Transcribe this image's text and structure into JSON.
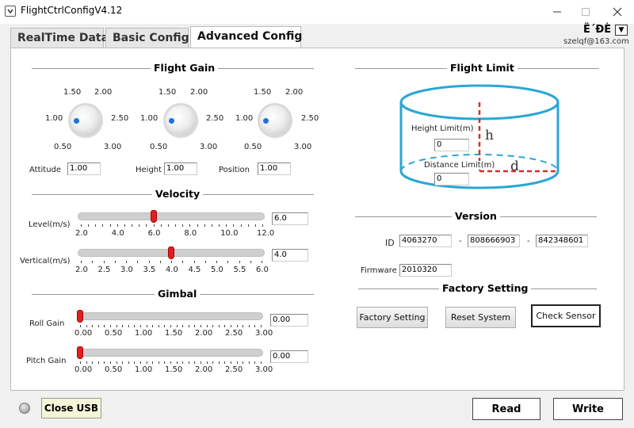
{
  "window": {
    "title": "FlightCtrlConfigV4.12"
  },
  "tabs": [
    {
      "label": "RealTime Data"
    },
    {
      "label": "Basic Config"
    },
    {
      "label": "Advanced Config"
    }
  ],
  "header": {
    "lang_text": "Ë´ÐÈ",
    "email": "szelqf@163.com"
  },
  "flight_gain": {
    "title": "Flight Gain",
    "scale_labels": [
      "1.00",
      "1.50",
      "2.00",
      "2.50",
      "0.50",
      "3.00"
    ],
    "knobs": [
      {
        "label": "Attitude",
        "value": "1.00"
      },
      {
        "label": "Height",
        "value": "1.00"
      },
      {
        "label": "Position",
        "value": "1.00"
      }
    ]
  },
  "velocity": {
    "title": "Velocity",
    "level": {
      "label": "Level(m/s)",
      "value": "6.0",
      "fraction": 0.5,
      "ticks": [
        "2.0",
        "4.0",
        "6.0",
        "8.0",
        "10.0",
        "12.0"
      ]
    },
    "vertical": {
      "label": "Vertical(m/s)",
      "value": "4.0",
      "fraction": 0.5,
      "ticks": [
        "2.0",
        "2.5",
        "3.0",
        "3.5",
        "4.0",
        "4.5",
        "5.0",
        "5.5",
        "6.0"
      ]
    }
  },
  "gimbal": {
    "title": "Gimbal",
    "roll": {
      "label": "Roll Gain",
      "value": "0.00",
      "fraction": 0.0
    },
    "pitch": {
      "label": "Pitch Gain",
      "value": "0.00",
      "fraction": 0.0
    },
    "ticks": [
      "0.00",
      "0.50",
      "1.00",
      "1.50",
      "2.00",
      "2.50",
      "3.00"
    ]
  },
  "flight_limit": {
    "title": "Flight Limit",
    "height_label": "Height Limit(m)",
    "height_value": "0",
    "distance_label": "Distance Limit(m)",
    "distance_value": "0",
    "h_mark": "h",
    "d_mark": "d"
  },
  "version": {
    "title": "Version",
    "id_label": "ID",
    "id_parts": [
      "4063270",
      "808666903",
      "842348601"
    ],
    "separator": "-",
    "firmware_label": "Firmware",
    "firmware_value": "2010320"
  },
  "factory": {
    "title": "Factory Setting",
    "buttons": [
      "Factory Setting",
      "Reset System",
      "Check Sensor"
    ]
  },
  "footer": {
    "close_usb": "Close USB",
    "read": "Read",
    "write": "Write"
  },
  "colors": {
    "cylinder": "#2aa6d6",
    "marker": "#d03030",
    "slider_thumb": "#e02020",
    "knob_dot": "#1f6fe0"
  }
}
